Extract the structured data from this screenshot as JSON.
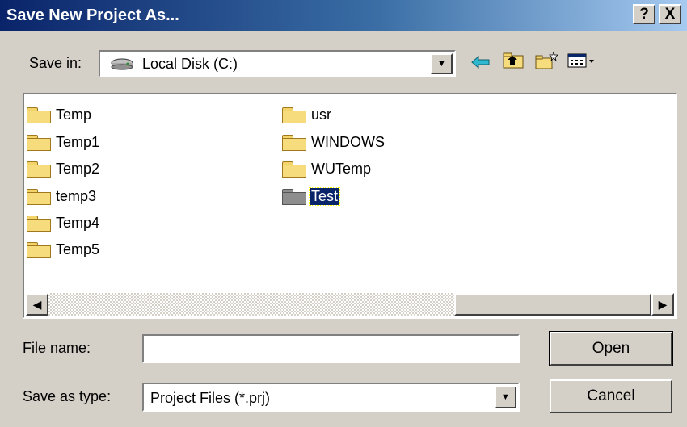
{
  "dialog": {
    "title": "Save New Project As...",
    "help_button": "?",
    "close_button": "X"
  },
  "save_in": {
    "label": "Save in:",
    "value": "Local Disk (C:)",
    "drive_icon": "hard-disk-icon",
    "dropdown_arrow": "▼"
  },
  "toolbar": {
    "back_icon": "⇦",
    "up_icon": "⮤",
    "new_folder_icon": "✱",
    "view_menu_icon": "▦▾"
  },
  "files": {
    "column1": [
      {
        "name": "Temp",
        "icon": "folder-icon"
      },
      {
        "name": "Temp1",
        "icon": "folder-icon"
      },
      {
        "name": "Temp2",
        "icon": "folder-icon"
      },
      {
        "name": "temp3",
        "icon": "folder-icon"
      },
      {
        "name": "Temp4",
        "icon": "folder-icon"
      },
      {
        "name": "Temp5",
        "icon": "folder-icon"
      }
    ],
    "column2": [
      {
        "name": "usr",
        "icon": "folder-icon"
      },
      {
        "name": "WINDOWS",
        "icon": "folder-icon"
      },
      {
        "name": "WUTemp",
        "icon": "folder-icon"
      },
      {
        "name": "Test",
        "icon": "folder-icon",
        "selected": true
      }
    ]
  },
  "scrollbar": {
    "left_arrow": "◀",
    "right_arrow": "▶"
  },
  "file_name": {
    "label": "File name:",
    "value": ""
  },
  "save_as_type": {
    "label": "Save as type:",
    "value": "Project Files (*.prj)",
    "dropdown_arrow": "▼"
  },
  "buttons": {
    "open": "Open",
    "cancel": "Cancel"
  },
  "colors": {
    "title_bar": "#0a246a",
    "dialog_bg": "#d4d0c8",
    "selection": "#0a246a",
    "folder": "#f7dc7d"
  }
}
